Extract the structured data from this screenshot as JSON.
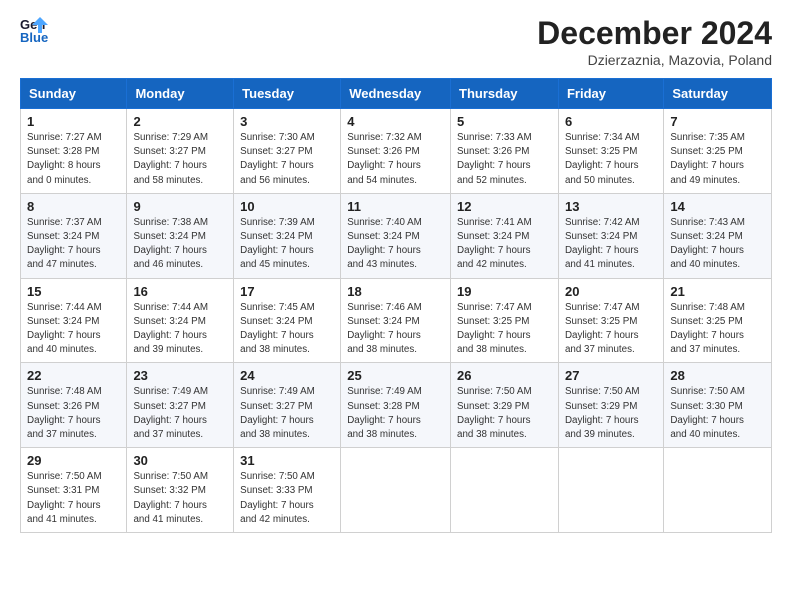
{
  "header": {
    "logo_line1": "General",
    "logo_line2": "Blue",
    "month_title": "December 2024",
    "subtitle": "Dzierzaznia, Mazovia, Poland"
  },
  "days_of_week": [
    "Sunday",
    "Monday",
    "Tuesday",
    "Wednesday",
    "Thursday",
    "Friday",
    "Saturday"
  ],
  "weeks": [
    [
      {
        "day": "1",
        "info": "Sunrise: 7:27 AM\nSunset: 3:28 PM\nDaylight: 8 hours\nand 0 minutes."
      },
      {
        "day": "2",
        "info": "Sunrise: 7:29 AM\nSunset: 3:27 PM\nDaylight: 7 hours\nand 58 minutes."
      },
      {
        "day": "3",
        "info": "Sunrise: 7:30 AM\nSunset: 3:27 PM\nDaylight: 7 hours\nand 56 minutes."
      },
      {
        "day": "4",
        "info": "Sunrise: 7:32 AM\nSunset: 3:26 PM\nDaylight: 7 hours\nand 54 minutes."
      },
      {
        "day": "5",
        "info": "Sunrise: 7:33 AM\nSunset: 3:26 PM\nDaylight: 7 hours\nand 52 minutes."
      },
      {
        "day": "6",
        "info": "Sunrise: 7:34 AM\nSunset: 3:25 PM\nDaylight: 7 hours\nand 50 minutes."
      },
      {
        "day": "7",
        "info": "Sunrise: 7:35 AM\nSunset: 3:25 PM\nDaylight: 7 hours\nand 49 minutes."
      }
    ],
    [
      {
        "day": "8",
        "info": "Sunrise: 7:37 AM\nSunset: 3:24 PM\nDaylight: 7 hours\nand 47 minutes."
      },
      {
        "day": "9",
        "info": "Sunrise: 7:38 AM\nSunset: 3:24 PM\nDaylight: 7 hours\nand 46 minutes."
      },
      {
        "day": "10",
        "info": "Sunrise: 7:39 AM\nSunset: 3:24 PM\nDaylight: 7 hours\nand 45 minutes."
      },
      {
        "day": "11",
        "info": "Sunrise: 7:40 AM\nSunset: 3:24 PM\nDaylight: 7 hours\nand 43 minutes."
      },
      {
        "day": "12",
        "info": "Sunrise: 7:41 AM\nSunset: 3:24 PM\nDaylight: 7 hours\nand 42 minutes."
      },
      {
        "day": "13",
        "info": "Sunrise: 7:42 AM\nSunset: 3:24 PM\nDaylight: 7 hours\nand 41 minutes."
      },
      {
        "day": "14",
        "info": "Sunrise: 7:43 AM\nSunset: 3:24 PM\nDaylight: 7 hours\nand 40 minutes."
      }
    ],
    [
      {
        "day": "15",
        "info": "Sunrise: 7:44 AM\nSunset: 3:24 PM\nDaylight: 7 hours\nand 40 minutes."
      },
      {
        "day": "16",
        "info": "Sunrise: 7:44 AM\nSunset: 3:24 PM\nDaylight: 7 hours\nand 39 minutes."
      },
      {
        "day": "17",
        "info": "Sunrise: 7:45 AM\nSunset: 3:24 PM\nDaylight: 7 hours\nand 38 minutes."
      },
      {
        "day": "18",
        "info": "Sunrise: 7:46 AM\nSunset: 3:24 PM\nDaylight: 7 hours\nand 38 minutes."
      },
      {
        "day": "19",
        "info": "Sunrise: 7:47 AM\nSunset: 3:25 PM\nDaylight: 7 hours\nand 38 minutes."
      },
      {
        "day": "20",
        "info": "Sunrise: 7:47 AM\nSunset: 3:25 PM\nDaylight: 7 hours\nand 37 minutes."
      },
      {
        "day": "21",
        "info": "Sunrise: 7:48 AM\nSunset: 3:25 PM\nDaylight: 7 hours\nand 37 minutes."
      }
    ],
    [
      {
        "day": "22",
        "info": "Sunrise: 7:48 AM\nSunset: 3:26 PM\nDaylight: 7 hours\nand 37 minutes."
      },
      {
        "day": "23",
        "info": "Sunrise: 7:49 AM\nSunset: 3:27 PM\nDaylight: 7 hours\nand 37 minutes."
      },
      {
        "day": "24",
        "info": "Sunrise: 7:49 AM\nSunset: 3:27 PM\nDaylight: 7 hours\nand 38 minutes."
      },
      {
        "day": "25",
        "info": "Sunrise: 7:49 AM\nSunset: 3:28 PM\nDaylight: 7 hours\nand 38 minutes."
      },
      {
        "day": "26",
        "info": "Sunrise: 7:50 AM\nSunset: 3:29 PM\nDaylight: 7 hours\nand 38 minutes."
      },
      {
        "day": "27",
        "info": "Sunrise: 7:50 AM\nSunset: 3:29 PM\nDaylight: 7 hours\nand 39 minutes."
      },
      {
        "day": "28",
        "info": "Sunrise: 7:50 AM\nSunset: 3:30 PM\nDaylight: 7 hours\nand 40 minutes."
      }
    ],
    [
      {
        "day": "29",
        "info": "Sunrise: 7:50 AM\nSunset: 3:31 PM\nDaylight: 7 hours\nand 41 minutes."
      },
      {
        "day": "30",
        "info": "Sunrise: 7:50 AM\nSunset: 3:32 PM\nDaylight: 7 hours\nand 41 minutes."
      },
      {
        "day": "31",
        "info": "Sunrise: 7:50 AM\nSunset: 3:33 PM\nDaylight: 7 hours\nand 42 minutes."
      },
      null,
      null,
      null,
      null
    ]
  ]
}
